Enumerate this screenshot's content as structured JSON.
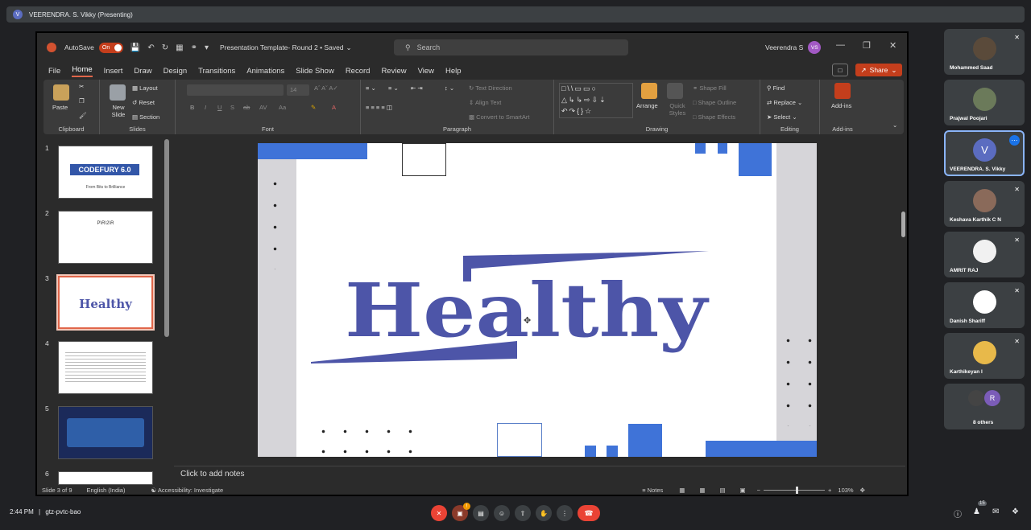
{
  "meet": {
    "presenter_label": "VEERENDRA. S. Vikky (Presenting)",
    "presenter_avatar": "V",
    "time": "2:44 PM",
    "meeting_code": "gtz-pvtc-bao",
    "people_count": "15",
    "participants": [
      {
        "name": "Mohammed Saad",
        "muted": true
      },
      {
        "name": "Prajwal Poojari",
        "muted": false
      },
      {
        "name": "VEERENDRA. S. Vikky",
        "initial": "V",
        "muted": false
      },
      {
        "name": "Keshava Karthik C N",
        "muted": true
      },
      {
        "name": "AMRIT RAJ",
        "muted": true
      },
      {
        "name": "Danish Shariff",
        "muted": true
      },
      {
        "name": "Karthikeyan I",
        "muted": true
      },
      {
        "name": "8 others",
        "initial": "R",
        "muted": false
      }
    ],
    "mic_badge": "!"
  },
  "ppt": {
    "autosave_label": "AutoSave",
    "autosave_state": "On",
    "doc_title": "Presentation Template- Round 2 • Saved",
    "search_placeholder": "Search",
    "user_name": "Veerendra S",
    "user_initials": "VS",
    "menu": [
      "File",
      "Home",
      "Insert",
      "Draw",
      "Design",
      "Transitions",
      "Animations",
      "Slide Show",
      "Record",
      "Review",
      "View",
      "Help"
    ],
    "active_menu": "Home",
    "share_label": "Share",
    "ribbon": {
      "clipboard": "Clipboard",
      "paste": "Paste",
      "slides": "Slides",
      "new_slide": "New Slide",
      "layout": "Layout",
      "reset": "Reset",
      "section": "Section",
      "font": "Font",
      "font_size": "14",
      "paragraph": "Paragraph",
      "text_direction": "Text Direction",
      "align_text": "Align Text",
      "convert_smartart": "Convert to SmartArt",
      "drawing": "Drawing",
      "arrange": "Arrange",
      "quick_styles": "Quick Styles",
      "shape_fill": "Shape Fill",
      "shape_outline": "Shape Outline",
      "shape_effects": "Shape Effects",
      "editing": "Editing",
      "find": "Find",
      "replace": "Replace",
      "select": "Select",
      "addins_group": "Add-ins",
      "addins": "Add-ins"
    },
    "slide_numbers": [
      "1",
      "2",
      "3",
      "4",
      "5",
      "6"
    ],
    "thumb1_title": "CODEFURY 6.0",
    "thumb1_sub": "From Bits to Brilliance",
    "thumb2_title": "P\\R\\2\\R",
    "thumb3_title": "Healthy",
    "slide_word": "Healthy",
    "notes_placeholder": "Click to add notes",
    "status": {
      "slide_of": "Slide 3 of 9",
      "language": "English (India)",
      "accessibility": "Accessibility: Investigate",
      "notes": "Notes",
      "zoom": "103%"
    },
    "colors": {
      "accent_blue": "#3f73d8",
      "word_color": "#4d55a8",
      "ppt_orange": "#c43e1c"
    }
  }
}
